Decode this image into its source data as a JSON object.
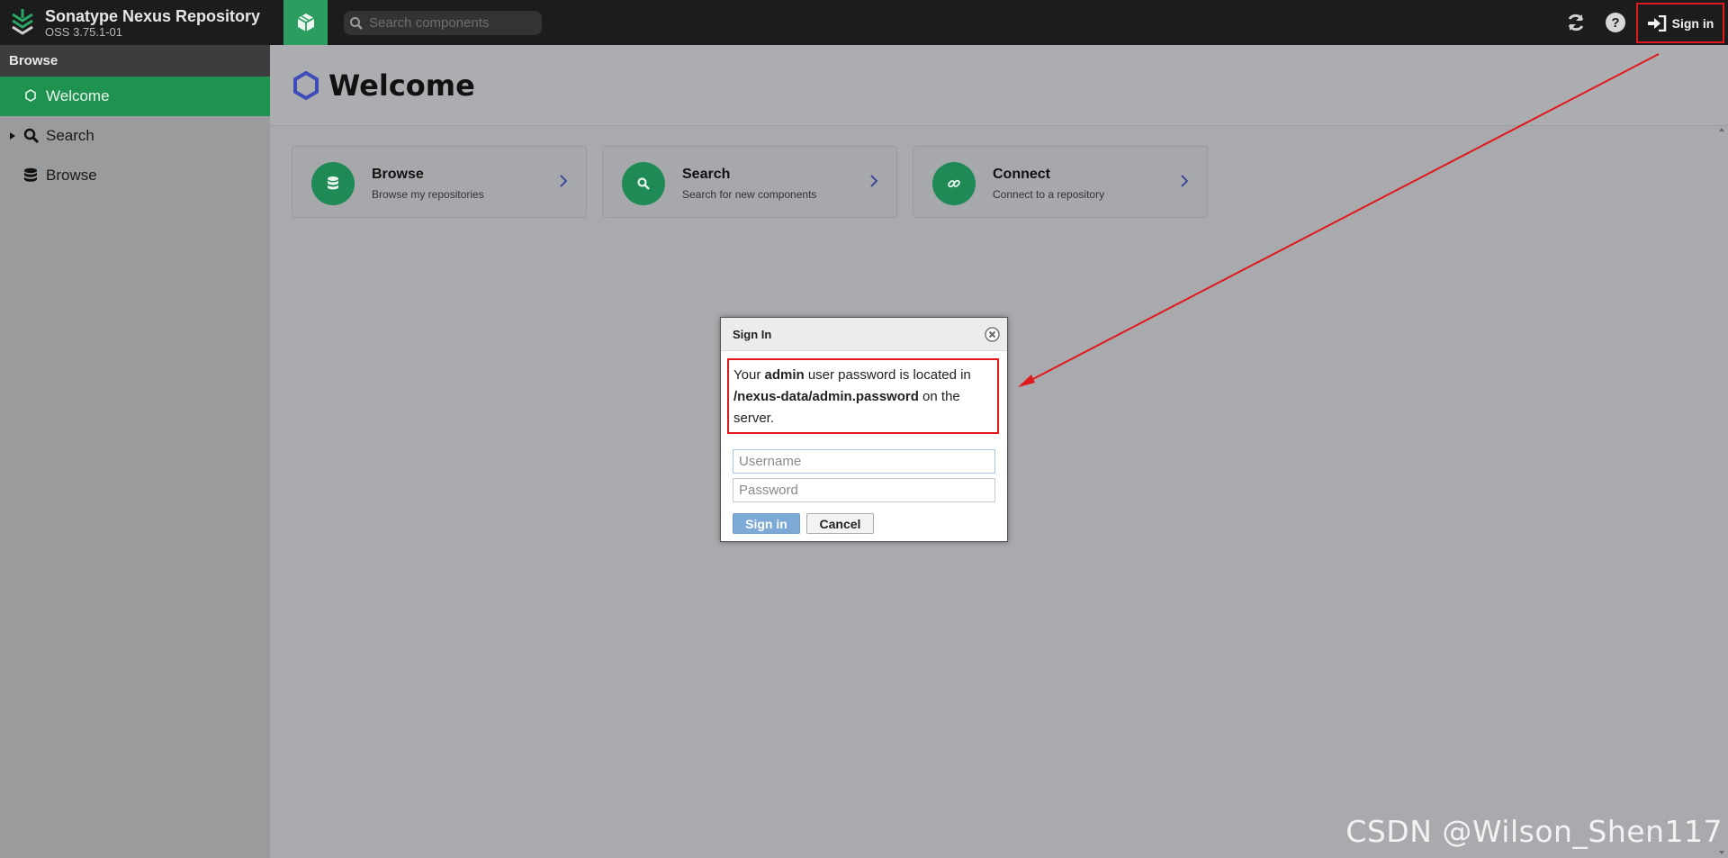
{
  "app": {
    "title": "Sonatype Nexus Repository",
    "version": "OSS 3.75.1-01"
  },
  "header": {
    "search_placeholder": "Search components",
    "signin_label": "Sign in",
    "icons": [
      "refresh-icon",
      "help-icon",
      "sign-in-icon"
    ]
  },
  "sidebar": {
    "section": "Browse",
    "items": [
      {
        "label": "Welcome",
        "icon": "hexagon-icon",
        "active": true
      },
      {
        "label": "Search",
        "icon": "search-icon",
        "active": false
      },
      {
        "label": "Browse",
        "icon": "database-icon",
        "active": false
      }
    ]
  },
  "main": {
    "page_title": "Welcome",
    "cards": [
      {
        "title": "Browse",
        "subtitle": "Browse my repositories",
        "icon": "database-icon"
      },
      {
        "title": "Search",
        "subtitle": "Search for new components",
        "icon": "search-icon"
      },
      {
        "title": "Connect",
        "subtitle": "Connect to a repository",
        "icon": "link-icon"
      }
    ]
  },
  "dialog": {
    "title": "Sign In",
    "notice": {
      "part1": "Your ",
      "admin": "admin",
      "part2": " user password is located in ",
      "path": "/nexus-data/admin.password",
      "part3": " on the server."
    },
    "username_placeholder": "Username",
    "password_placeholder": "Password",
    "signin_button": "Sign in",
    "cancel_button": "Cancel"
  },
  "colors": {
    "accent_green": "#1f9250",
    "highlight_red": "#e0191c"
  },
  "watermark": "CSDN @Wilson_Shen117"
}
